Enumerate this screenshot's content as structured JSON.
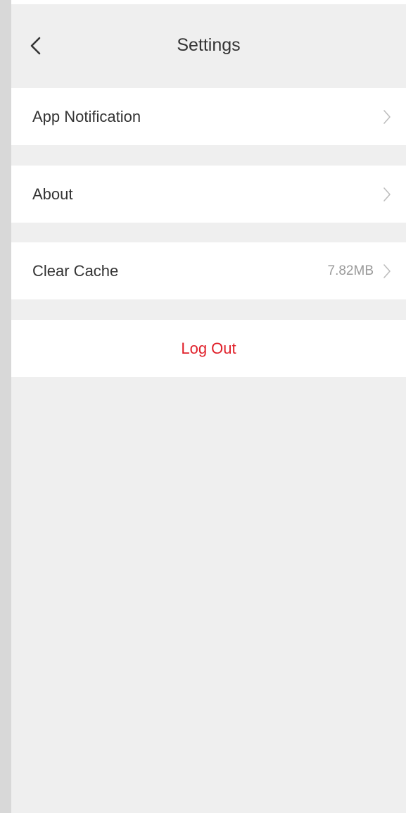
{
  "header": {
    "title": "Settings",
    "back_icon": "chevron-left-icon"
  },
  "menu": {
    "items": [
      {
        "label": "App Notification",
        "value": "",
        "icon": "chevron-right-icon"
      },
      {
        "label": "About",
        "value": "",
        "icon": "chevron-right-icon"
      },
      {
        "label": "Clear Cache",
        "value": "7.82MB",
        "icon": "chevron-right-icon"
      }
    ],
    "logout_label": "Log Out"
  },
  "colors": {
    "background": "#efefef",
    "row_background": "#ffffff",
    "text_primary": "#333333",
    "text_secondary": "#9a9a9a",
    "chevron": "#bdbdbd",
    "logout": "#e0202a"
  }
}
